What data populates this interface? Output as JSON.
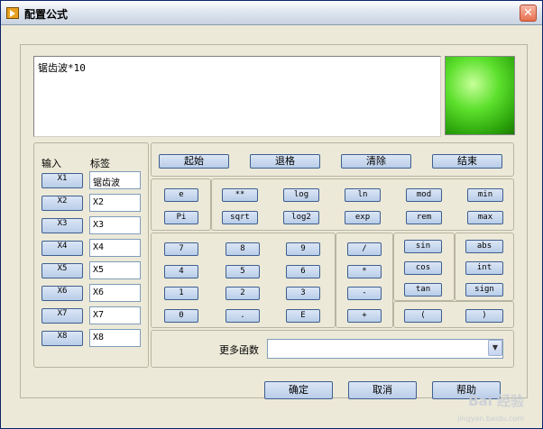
{
  "window": {
    "title": "配置公式",
    "close_label": "✕"
  },
  "formula": {
    "text": "锯齿波*10"
  },
  "indicator": {
    "color": "#3fd01a"
  },
  "inputs": {
    "header_input": "输入",
    "header_label": "标签",
    "rows": [
      {
        "btn": "X1",
        "label": "锯齿波"
      },
      {
        "btn": "X2",
        "label": "X2"
      },
      {
        "btn": "X3",
        "label": "X3"
      },
      {
        "btn": "X4",
        "label": "X4"
      },
      {
        "btn": "X5",
        "label": "X5"
      },
      {
        "btn": "X6",
        "label": "X6"
      },
      {
        "btn": "X7",
        "label": "X7"
      },
      {
        "btn": "X8",
        "label": "X8"
      }
    ]
  },
  "controls": {
    "start": "起始",
    "backspace": "退格",
    "clear": "清除",
    "end": "结束"
  },
  "constants": {
    "e": "e",
    "pi": "Pi"
  },
  "functions": {
    "pow": "**",
    "log": "log",
    "ln": "ln",
    "mod": "mod",
    "min": "min",
    "sqrt": "sqrt",
    "log2": "log2",
    "exp": "exp",
    "rem": "rem",
    "max": "max"
  },
  "digits": {
    "d7": "7",
    "d8": "8",
    "d9": "9",
    "d4": "4",
    "d5": "5",
    "d6": "6",
    "d1": "1",
    "d2": "2",
    "d3": "3",
    "d0": "0",
    "dot": ".",
    "exp_e": "E"
  },
  "operators": {
    "div": "/",
    "mul": "*",
    "sub": "-",
    "add": "+"
  },
  "trig": {
    "sin": "sin",
    "cos": "cos",
    "tan": "tan"
  },
  "misc": {
    "abs": "abs",
    "int": "int",
    "sign": "sign",
    "lparen": "(",
    "rparen": ")"
  },
  "more": {
    "label": "更多函数",
    "value": ""
  },
  "dialog": {
    "ok": "确定",
    "cancel": "取消",
    "help": "帮助"
  },
  "watermark": {
    "text": "Bai 经验",
    "sub": "jingyan.baidu.com"
  }
}
